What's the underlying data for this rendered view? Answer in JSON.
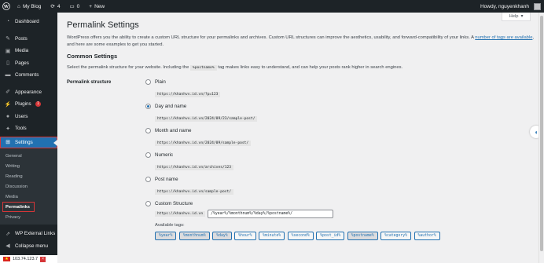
{
  "adminbar": {
    "site_name": "My Blog",
    "updates_count": "4",
    "comments_count": "0",
    "new_label": "New",
    "howdy": "Howdy, nguyenkhanh"
  },
  "sidebar": {
    "dashboard": "Dashboard",
    "posts": "Posts",
    "media": "Media",
    "pages": "Pages",
    "comments": "Comments",
    "appearance": "Appearance",
    "plugins": "Plugins",
    "plugins_badge": "1",
    "users": "Users",
    "tools": "Tools",
    "settings": "Settings",
    "submenu": [
      "General",
      "Writing",
      "Reading",
      "Discussion",
      "Media",
      "Permalinks",
      "Privacy"
    ],
    "wp_external_links": "WP External Links",
    "collapse": "Collapse menu"
  },
  "tray": {
    "ip": "103.74.123.7"
  },
  "help": {
    "label": "Help"
  },
  "page": {
    "title": "Permalink Settings",
    "intro_text": "WordPress offers you the ability to create a custom URL structure for your permalinks and archives. Custom URL structures can improve the aesthetics, usability, and forward-compatibility of your links. A ",
    "intro_link": "number of tags are available",
    "intro_tail": ", and here are some examples to get you started.",
    "section_title": "Common Settings",
    "desc_pre": "Select the permalink structure for your website. Including the ",
    "desc_code": "%postname%",
    "desc_post": " tag makes links easy to understand, and can help your posts rank higher in search engines.",
    "row_label": "Permalink structure"
  },
  "options": [
    {
      "label": "Plain",
      "example": "https://khanhvv.id.vn/?p=123",
      "checked": false
    },
    {
      "label": "Day and name",
      "example": "https://khanhvv.id.vn/2024/09/23/sample-post/",
      "checked": true
    },
    {
      "label": "Month and name",
      "example": "https://khanhvv.id.vn/2024/09/sample-post/",
      "checked": false
    },
    {
      "label": "Numeric",
      "example": "https://khanhvv.id.vn/archives/123",
      "checked": false
    },
    {
      "label": "Post name",
      "example": "https://khanhvv.id.vn/sample-post/",
      "checked": false
    }
  ],
  "custom": {
    "label": "Custom Structure",
    "prefix": "https://khanhvv.id.vn",
    "value": "/%year%/%monthnum%/%day%/%postname%/",
    "available_tags_label": "Available tags:",
    "tags": [
      "%year%",
      "%monthnum%",
      "%day%",
      "%hour%",
      "%minute%",
      "%second%",
      "%post_id%",
      "%postname%",
      "%category%",
      "%author%"
    ],
    "active_tags": [
      "%year%",
      "%monthnum%",
      "%day%",
      "%postname%"
    ]
  },
  "colors": {
    "accent": "#2271b1",
    "sidebar_bg": "#1d2327",
    "highlight_box": "#d63638"
  }
}
